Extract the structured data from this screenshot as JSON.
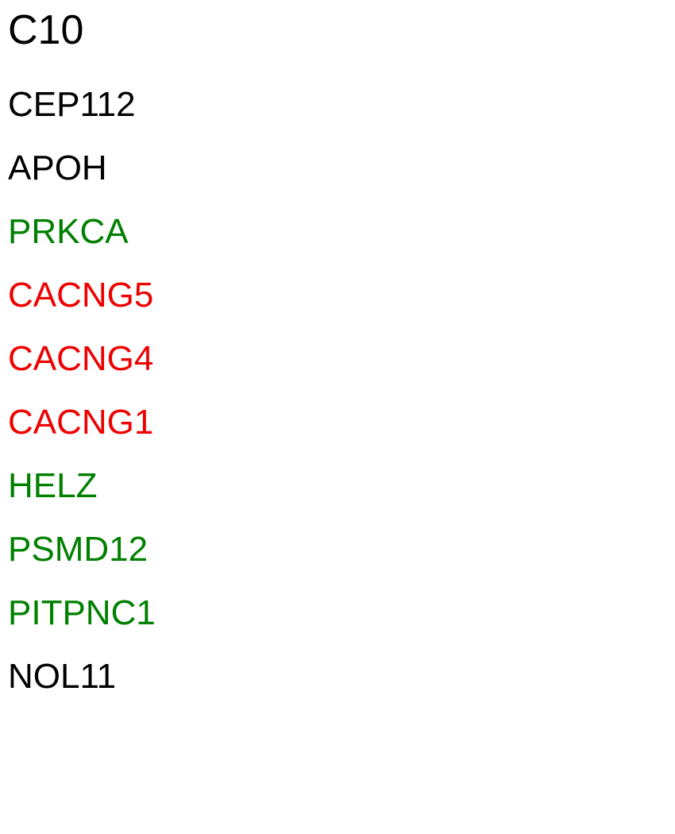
{
  "title": "C10",
  "colors": {
    "neutral": "#000000",
    "green": "#008000",
    "red": "#ee0000"
  },
  "genes": [
    {
      "name": "CEP112",
      "color": "#000000"
    },
    {
      "name": "APOH",
      "color": "#000000"
    },
    {
      "name": "PRKCA",
      "color": "#008000"
    },
    {
      "name": "CACNG5",
      "color": "#ee0000"
    },
    {
      "name": "CACNG4",
      "color": "#ee0000"
    },
    {
      "name": "CACNG1",
      "color": "#ee0000"
    },
    {
      "name": "HELZ",
      "color": "#008000"
    },
    {
      "name": "PSMD12",
      "color": "#008000"
    },
    {
      "name": "PITPNC1",
      "color": "#008000"
    },
    {
      "name": "NOL11",
      "color": "#000000"
    }
  ]
}
